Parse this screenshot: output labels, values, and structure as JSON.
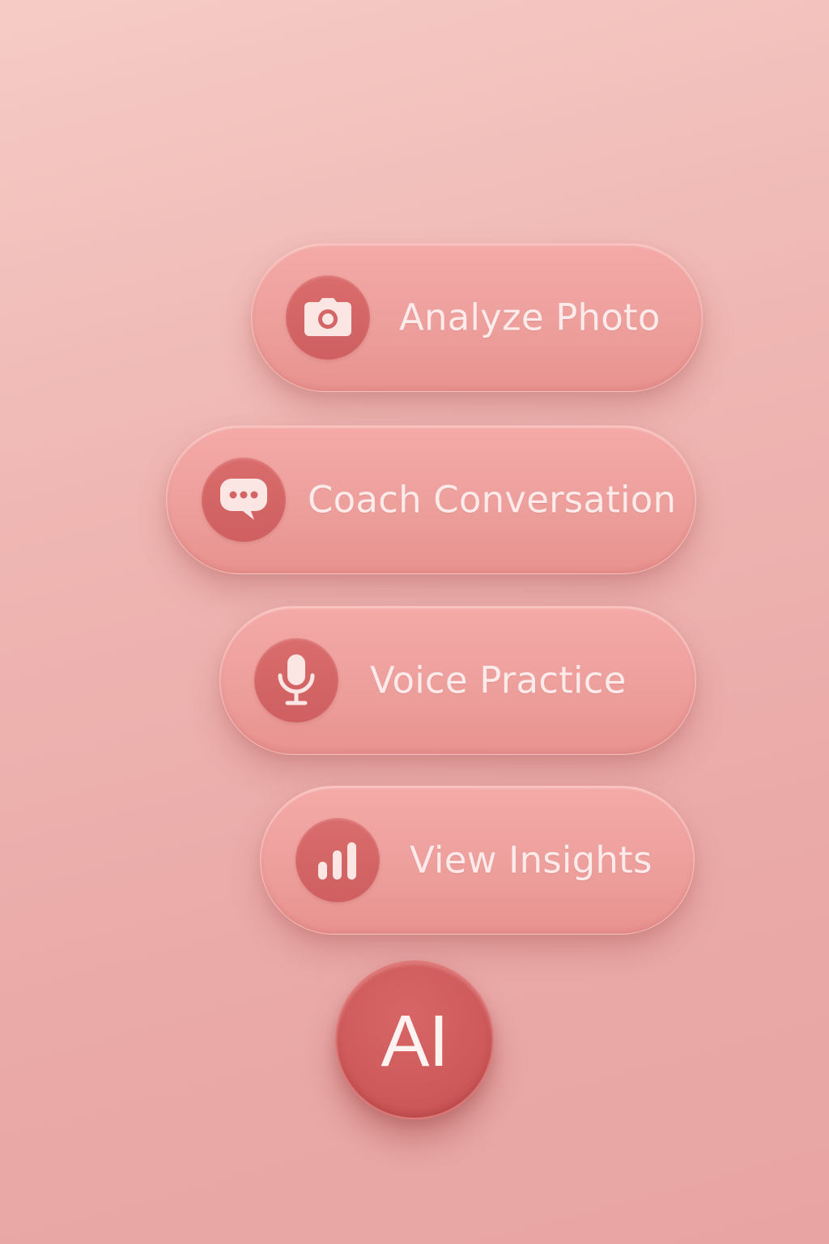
{
  "menu": {
    "items": [
      {
        "id": "analyze",
        "label": "Analyze Photo",
        "icon": "camera-icon"
      },
      {
        "id": "coach",
        "label": "Coach Conversation",
        "icon": "chat-bubble-icon"
      },
      {
        "id": "voice",
        "label": "Voice Practice",
        "icon": "microphone-icon"
      },
      {
        "id": "insights",
        "label": "View Insights",
        "icon": "bar-chart-icon"
      }
    ]
  },
  "fab": {
    "label": "AI"
  },
  "colors": {
    "background": "#f0b8b4",
    "pill": "#ee9f9c",
    "icon_circle": "#d46566",
    "fab": "#cf5b5c",
    "text": "#fcebea"
  }
}
